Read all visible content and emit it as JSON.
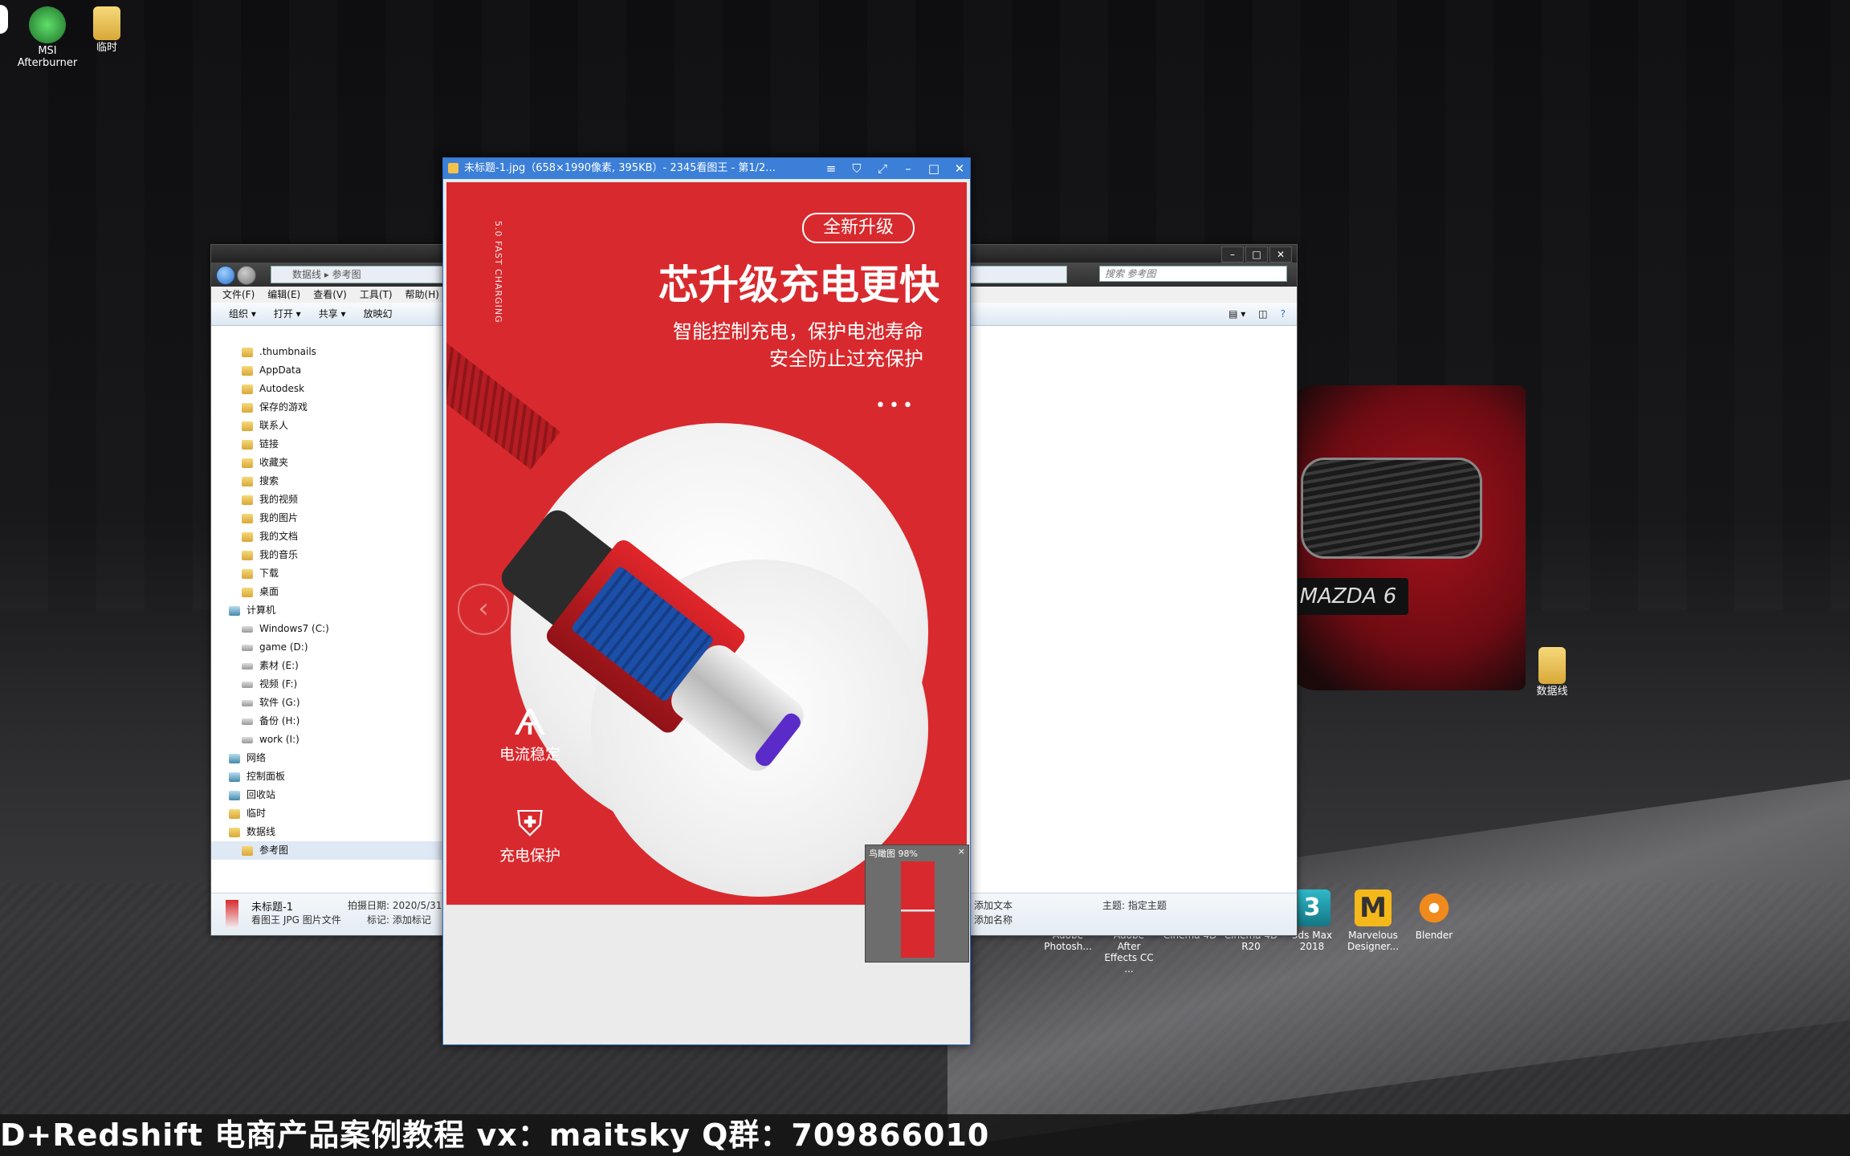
{
  "desktop": {
    "icons": [
      {
        "label": "MSI\nAfterburner",
        "label_line1": "MSI",
        "label_line2": "Afterburner"
      },
      {
        "label": "临时"
      },
      {
        "label": "数据线"
      }
    ],
    "car_plate": "MAZDA 6",
    "app_icons": [
      {
        "label_line1": "Adobe",
        "label_line2": "Photosh..."
      },
      {
        "label_line1": "Adobe After",
        "label_line2": "Effects CC ..."
      },
      {
        "label_line1": "Cinema 4D",
        "label_line2": ""
      },
      {
        "label_line1": "Cinema 4D",
        "label_line2": "R20"
      },
      {
        "label_line1": "3ds Max",
        "label_line2": "2018"
      },
      {
        "label_line1": "Marvelous",
        "label_line2": "Designer..."
      },
      {
        "label_line1": "Blender",
        "label_line2": ""
      }
    ]
  },
  "explorer": {
    "breadcrumb": [
      "数据线",
      "参考图"
    ],
    "search_placeholder": "搜索 参考图",
    "menu": [
      "文件(F)",
      "编辑(E)",
      "查看(V)",
      "工具(T)",
      "帮助(H)"
    ],
    "toolbar": [
      "组织 ▾",
      "打开 ▾",
      "共享 ▾",
      "放映幻"
    ],
    "tree": [
      {
        "label": ".thumbnails",
        "type": "folder"
      },
      {
        "label": "AppData",
        "type": "folder"
      },
      {
        "label": "Autodesk",
        "type": "folder"
      },
      {
        "label": "保存的游戏",
        "type": "folder"
      },
      {
        "label": "联系人",
        "type": "folder"
      },
      {
        "label": "链接",
        "type": "folder"
      },
      {
        "label": "收藏夹",
        "type": "folder"
      },
      {
        "label": "搜索",
        "type": "folder"
      },
      {
        "label": "我的视频",
        "type": "folder"
      },
      {
        "label": "我的图片",
        "type": "folder"
      },
      {
        "label": "我的文档",
        "type": "folder"
      },
      {
        "label": "我的音乐",
        "type": "folder"
      },
      {
        "label": "下载",
        "type": "folder"
      },
      {
        "label": "桌面",
        "type": "folder"
      },
      {
        "label": "计算机",
        "type": "computer"
      },
      {
        "label": "Windows7 (C:)",
        "type": "drive"
      },
      {
        "label": "game (D:)",
        "type": "drive"
      },
      {
        "label": "素材 (E:)",
        "type": "drive"
      },
      {
        "label": "视频 (F:)",
        "type": "drive"
      },
      {
        "label": "软件 (G:)",
        "type": "drive"
      },
      {
        "label": "备份 (H:)",
        "type": "drive"
      },
      {
        "label": "work (I:)",
        "type": "drive"
      },
      {
        "label": "网络",
        "type": "computer"
      },
      {
        "label": "控制面板",
        "type": "computer"
      },
      {
        "label": "回收站",
        "type": "computer"
      },
      {
        "label": "临时",
        "type": "folder"
      },
      {
        "label": "数据线",
        "type": "folder"
      },
      {
        "label": "参考图",
        "type": "folder",
        "selected": true
      }
    ],
    "details": {
      "filename": "未标题-1",
      "filetype": "看图王 JPG 图片文件",
      "date_label": "拍摄日期: 2020/5/31",
      "tag_label": "标记: 添加标记",
      "add_text": "添加文本",
      "add_name": "添加名称",
      "subject": "主题: 指定主题"
    }
  },
  "viewer": {
    "title": "未标题-1.jpg（658×1990像素, 395KB）- 2345看图王 - 第1/2...",
    "poster": {
      "vertical_text": "5.0 FAST CHARGING",
      "badge": "全新升级",
      "headline": "芯升级充电更快",
      "sub1": "智能控制充电，保护电池寿命",
      "sub2": "安全防止过充保护",
      "dots": "•••",
      "feature1": "电流稳定",
      "feature2": "充电保护"
    },
    "navigator": {
      "label": "鸟瞰图 98%",
      "close": "×"
    }
  },
  "banner": {
    "text": "D+Redshift 电商产品案例教程      vx：maitsky     Q群：709866010"
  },
  "colors": {
    "poster_red": "#d82a2e",
    "viewer_title": "#3b7fd8"
  }
}
